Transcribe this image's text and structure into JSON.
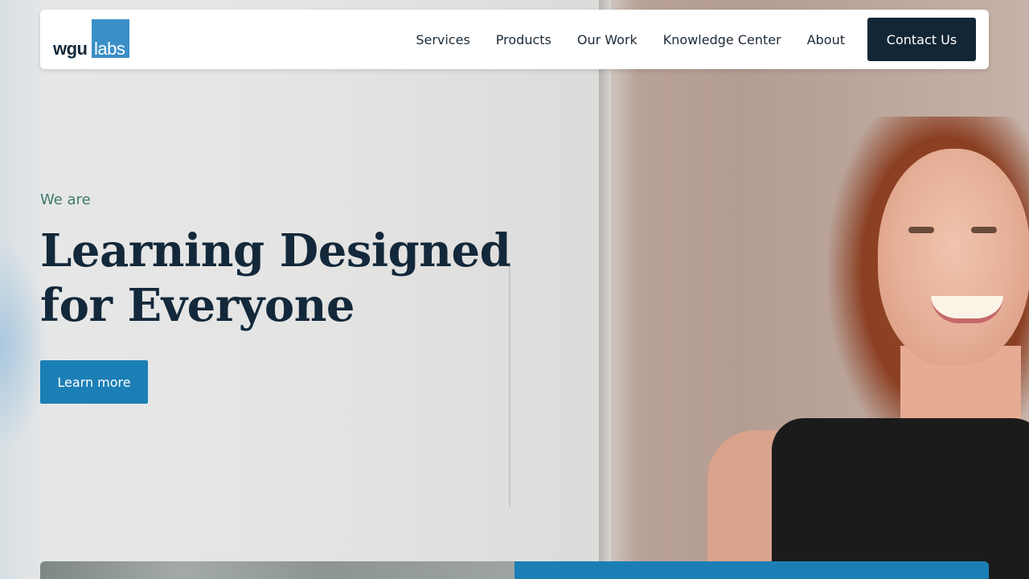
{
  "brand": {
    "logo_left": "wgu",
    "logo_right": "labs",
    "logo_color": "#3b8fc7"
  },
  "nav": {
    "items": [
      {
        "label": "Services"
      },
      {
        "label": "Products"
      },
      {
        "label": "Our Work"
      },
      {
        "label": "Knowledge Center"
      },
      {
        "label": "About"
      }
    ],
    "cta_label": "Contact Us"
  },
  "hero": {
    "eyebrow": "We are",
    "headline_line1": "Learning Designed",
    "headline_line2": "for Everyone",
    "button_label": "Learn more",
    "accent_color": "#1b7fb6",
    "headline_color": "#13283a"
  }
}
